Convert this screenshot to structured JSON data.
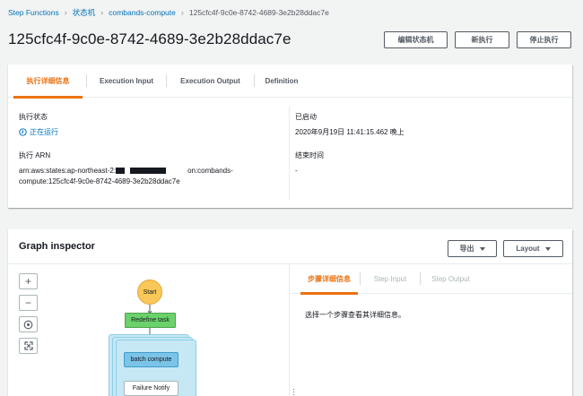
{
  "breadcrumb": {
    "items": [
      "Step Functions",
      "状态机",
      "combands-compute"
    ],
    "current": "125cfc4f-9c0e-8742-4689-3e2b28ddac7e"
  },
  "page": {
    "title": "125cfc4f-9c0e-8742-4689-3e2b28ddac7e"
  },
  "actions": {
    "edit_label": "编辑状态机",
    "new_label": "新执行",
    "stop_label": "停止执行"
  },
  "tabs": [
    {
      "label": "执行详细信息",
      "active": true
    },
    {
      "label": "Execution Input",
      "active": false
    },
    {
      "label": "Execution Output",
      "active": false
    },
    {
      "label": "Definition",
      "active": false
    }
  ],
  "details": {
    "status_label": "执行状态",
    "status_value": "正在运行",
    "arn_label": "执行 ARN",
    "arn_line1_a": "arn:aws:states:ap-northeast-2:",
    "arn_line1_b": "on:combands-",
    "arn_line2": "compute:125cfc4f-9c0e-8742-4689-3e2b28ddac7e",
    "started_label": "已启动",
    "started_value": "2020年9月19日 11:41:15.462 晚上",
    "ended_label": "结束时间",
    "ended_value": "-"
  },
  "graph": {
    "title": "Graph inspector",
    "export_label": "导出",
    "layout_label": "Layout",
    "zoom_in": "+",
    "zoom_out": "−",
    "nodes": {
      "start": "Start",
      "redefine": "Redefine task",
      "batch": "batch compute",
      "failure": "Failure Notify"
    }
  },
  "step_panel": {
    "tabs": [
      {
        "label": "步骤详细信息",
        "active": true
      },
      {
        "label": "Step Input",
        "active": false
      },
      {
        "label": "Step Output",
        "active": false
      }
    ],
    "hint": "选择一个步骤查看其详细信息。"
  },
  "colors": {
    "accent": "#ec7211",
    "link": "#0073bb",
    "start_node": "#f9c858",
    "task_node": "#6bd16b",
    "map_node": "#c6e8f5",
    "batch_node": "#7cc3e8"
  },
  "icons": {
    "status": "running-clock-icon",
    "breadcrumb_separator": "chevron-right-icon",
    "dropdown": "caret-down-icon",
    "center": "target-icon",
    "fit": "fit-to-screen-icon",
    "drag": "drag-handle-icon"
  }
}
